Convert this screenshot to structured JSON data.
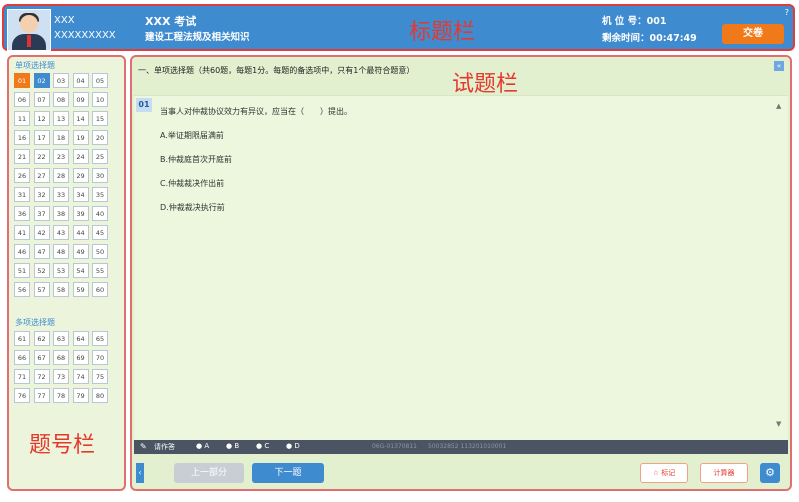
{
  "header": {
    "candidate_name": "XXX",
    "candidate_id": "XXXXXXXXX",
    "exam_title": "XXX 考试",
    "exam_subject": "建设工程法规及相关知识",
    "annotation": "标题栏",
    "machine_label": "机 位 号：001",
    "time_label": "剩余时间：00:47:49",
    "submit_label": "交卷",
    "help_mark": "?"
  },
  "sidebar": {
    "single_section_label": "单项选择题",
    "multi_section_label": "多项选择题",
    "annotation": "题号栏",
    "single_numbers": [
      "01",
      "02",
      "03",
      "04",
      "05",
      "06",
      "07",
      "08",
      "09",
      "10",
      "11",
      "12",
      "13",
      "14",
      "15",
      "16",
      "17",
      "18",
      "19",
      "20",
      "21",
      "22",
      "23",
      "24",
      "25",
      "26",
      "27",
      "28",
      "29",
      "30",
      "31",
      "32",
      "33",
      "34",
      "35",
      "36",
      "37",
      "38",
      "39",
      "40",
      "41",
      "42",
      "43",
      "44",
      "45",
      "46",
      "47",
      "48",
      "49",
      "50",
      "51",
      "52",
      "53",
      "54",
      "55",
      "56",
      "57",
      "58",
      "59",
      "60"
    ],
    "multi_numbers": [
      "61",
      "62",
      "63",
      "64",
      "65",
      "66",
      "67",
      "68",
      "69",
      "70",
      "71",
      "72",
      "73",
      "74",
      "75",
      "76",
      "77",
      "78",
      "79",
      "80"
    ],
    "current_question": "01",
    "answered_questions": [
      "02"
    ]
  },
  "main": {
    "section_title": "一、单项选择题（共60题，每题1分。每题的备选项中，只有1个最符合题意）",
    "annotation": "试题栏",
    "expand_icon": "«",
    "question_number": "01",
    "question_text": "当事人对仲裁协议效力有异议，应当在（　　）提出。",
    "options": [
      "A.举证期限届满前",
      "B.仲裁庭首次开庭前",
      "C.仲裁裁决作出前",
      "D.仲裁裁决执行前"
    ]
  },
  "answer_bar": {
    "label": "请作答",
    "choices": [
      "A",
      "B",
      "C",
      "D"
    ],
    "code1": "06G-01370811",
    "code2": "50032852 113201010001"
  },
  "bottom": {
    "prev_label": "上一部分",
    "next_label": "下一题",
    "mark_label": "标记",
    "calc_label": "计算器",
    "left_arrow": "‹",
    "mark_icon": "☆",
    "gear_icon": "⚙"
  },
  "colors": {
    "header_blue": "#3e8bd0",
    "submit_orange": "#f07a1a",
    "annotation_red": "#e5392e",
    "panel_green": "#e3f0cf"
  }
}
